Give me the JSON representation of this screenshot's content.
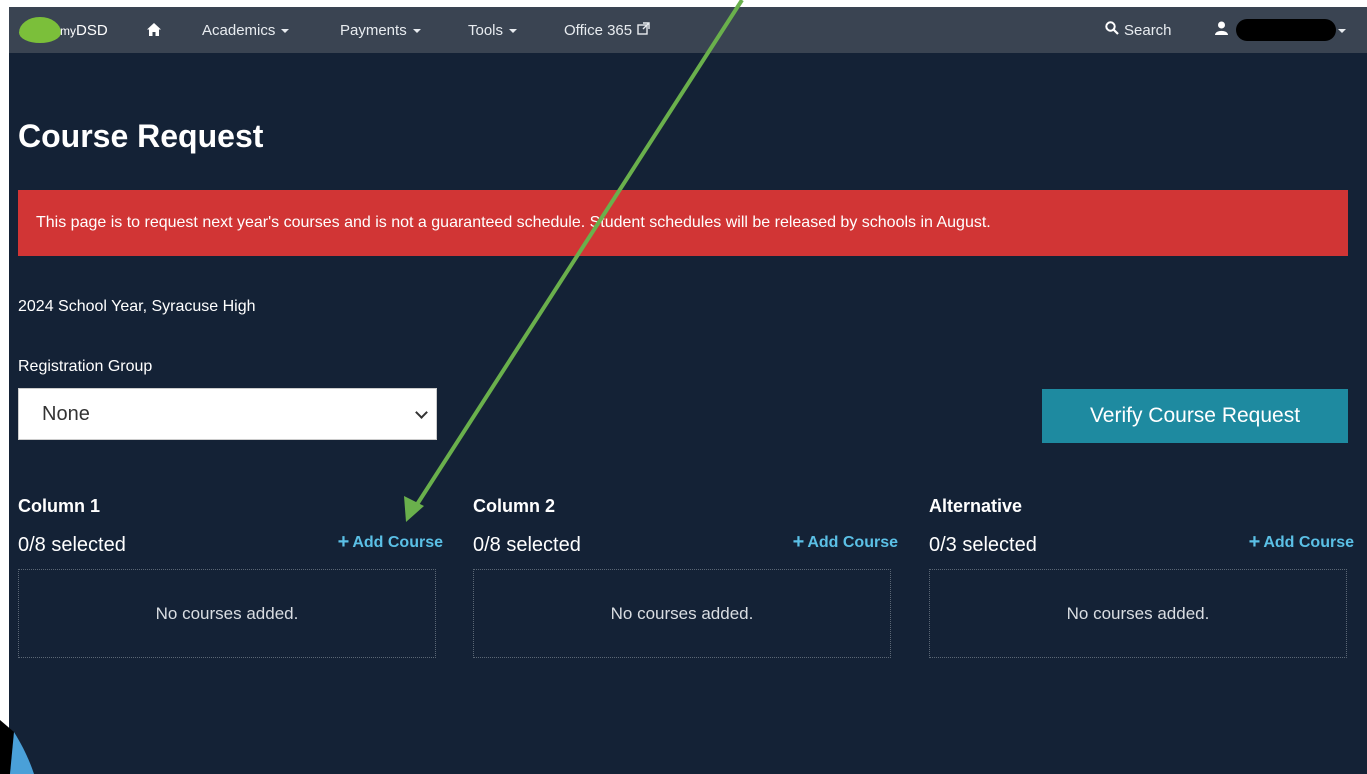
{
  "navbar": {
    "brand_prefix": "my",
    "brand_name": "DSD",
    "items": [
      {
        "label": "Academics"
      },
      {
        "label": "Payments"
      },
      {
        "label": "Tools"
      },
      {
        "label": "Office 365"
      }
    ],
    "search_label": "Search"
  },
  "page": {
    "title": "Course Request",
    "alert": "This page is to request next year's courses and is not a guaranteed schedule. Student schedules will be released by schools in August.",
    "school_year": "2024 School Year, Syracuse High",
    "registration_group_label": "Registration Group",
    "registration_group_value": "None",
    "verify_button": "Verify Course Request"
  },
  "columns": [
    {
      "title": "Column 1",
      "count": "0/8 selected",
      "add_label": "Add Course",
      "empty_text": "No courses added."
    },
    {
      "title": "Column 2",
      "count": "0/8 selected",
      "add_label": "Add Course",
      "empty_text": "No courses added."
    },
    {
      "title": "Alternative",
      "count": "0/3 selected",
      "add_label": "Add Course",
      "empty_text": "No courses added."
    }
  ],
  "annotation": {
    "arrow_color": "#6ab04c"
  },
  "colors": {
    "background": "#142236",
    "navbar": "#3a4452",
    "alert": "#d13535",
    "verify": "#1e8aa0",
    "link": "#5bc0e6",
    "logo": "#7bbf3a"
  }
}
